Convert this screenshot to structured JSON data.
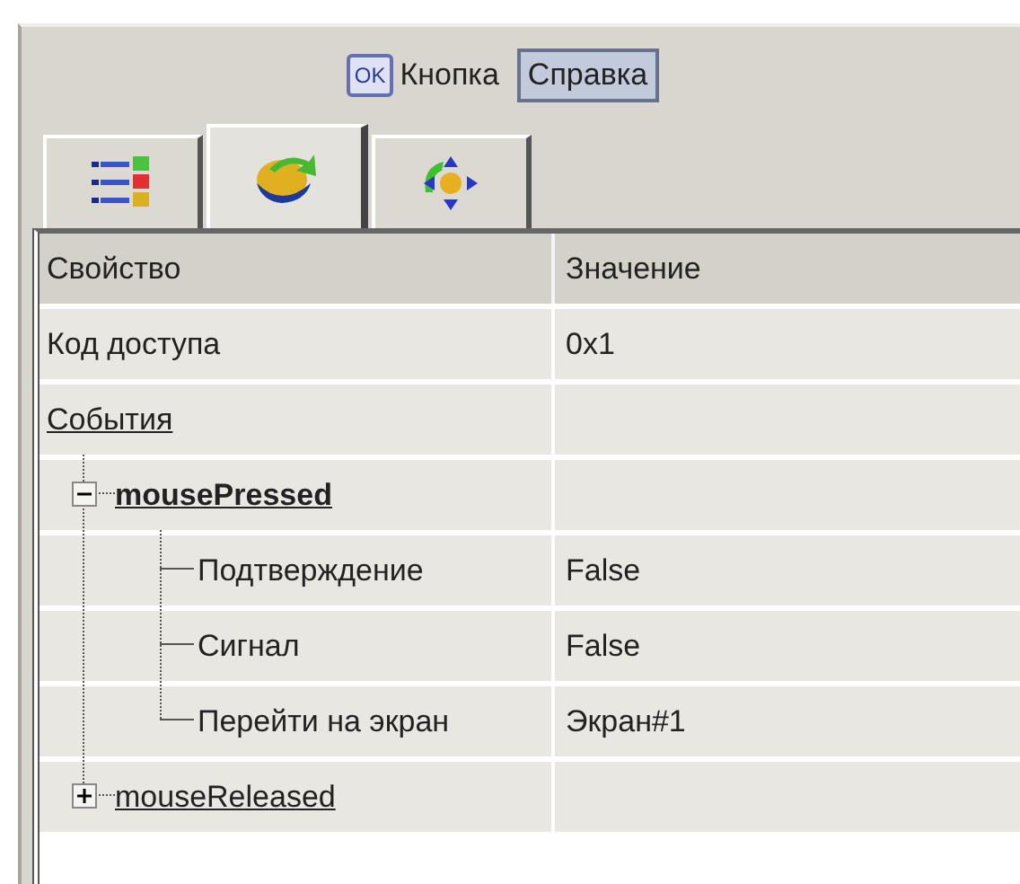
{
  "toolbar": {
    "icon_label": "OK",
    "label": "Кнопка",
    "help_button": "Справка"
  },
  "tabs": [
    {
      "kind": "list",
      "selected": false
    },
    {
      "kind": "events",
      "selected": true
    },
    {
      "kind": "layout",
      "selected": false
    }
  ],
  "grid": {
    "columns": [
      "Свойство",
      "Значение"
    ],
    "rows": [
      {
        "name": "Код доступа",
        "value": "0x1"
      },
      {
        "name": "События",
        "kind": "link",
        "children": [
          {
            "name": "mousePressed",
            "kind": "event",
            "selected": true,
            "expanded": true,
            "children": [
              {
                "name": "Подтверждение",
                "value": "False"
              },
              {
                "name": "Сигнал",
                "value": "False"
              },
              {
                "name": "Перейти на экран",
                "value": "Экран#1"
              }
            ]
          },
          {
            "name": "mouseReleased",
            "kind": "event",
            "selected": false,
            "expanded": false
          }
        ]
      }
    ]
  }
}
